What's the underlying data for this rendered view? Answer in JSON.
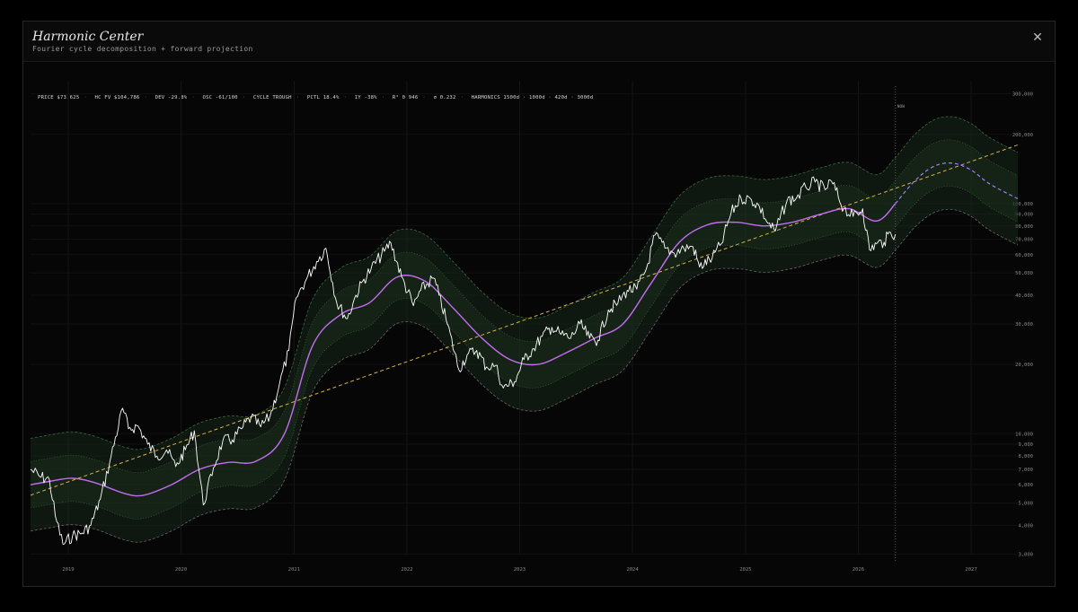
{
  "window": {
    "title": "Harmonic Center",
    "subtitle": "Fourier cycle decomposition + forward projection",
    "close_label": "✕"
  },
  "stats": [
    "PRICE $73,625",
    "HC FV $104,786",
    "DEV -29.8%",
    "OSC -61/100",
    "CYCLE TROUGH",
    "PCTL 18.4%",
    "1Y -38%",
    "R² 0.946",
    "σ 0.232",
    "HARMONICS 1500d · 1000d · 420d · 3000d"
  ],
  "colors": {
    "price": "#ffffff",
    "center": "#c56cf0",
    "projection": "#9f7cf5",
    "trend": "#d8b04a",
    "band_fill": "#1a2e1c",
    "band_line": "#3c6a40"
  },
  "chart_data": {
    "type": "line",
    "y_scale": "log",
    "ylim": [
      2800,
      330000
    ],
    "xlim": [
      "2018-09-01",
      "2027-06-01"
    ],
    "now_label": "NOW",
    "now_date": "2026-05-01",
    "x_ticks": [
      "2019",
      "2020",
      "2021",
      "2022",
      "2023",
      "2024",
      "2025",
      "2026",
      "2027"
    ],
    "y_ticks": [
      {
        "value": 300000,
        "label": "300,000"
      },
      {
        "value": 200000,
        "label": "200,000"
      },
      {
        "value": 100000,
        "label": "100,000"
      },
      {
        "value": 90000,
        "label": "90,000"
      },
      {
        "value": 80000,
        "label": "80,000"
      },
      {
        "value": 70000,
        "label": "70,000"
      },
      {
        "value": 60000,
        "label": "60,000"
      },
      {
        "value": 50000,
        "label": "50,000"
      },
      {
        "value": 40000,
        "label": "40,000"
      },
      {
        "value": 30000,
        "label": "30,000"
      },
      {
        "value": 20000,
        "label": "20,000"
      },
      {
        "value": 10000,
        "label": "10,000"
      },
      {
        "value": 9000,
        "label": "9,000"
      },
      {
        "value": 8000,
        "label": "8,000"
      },
      {
        "value": 7000,
        "label": "7,000"
      },
      {
        "value": 6000,
        "label": "6,000"
      },
      {
        "value": 5000,
        "label": "5,000"
      },
      {
        "value": 4000,
        "label": "4,000"
      },
      {
        "value": 3000,
        "label": "3,000"
      }
    ],
    "series": [
      {
        "role": "price",
        "x": [
          "2018-09-01",
          "2018-10-01",
          "2018-11-01",
          "2018-11-20",
          "2018-12-15",
          "2019-01-15",
          "2019-02-15",
          "2019-03-15",
          "2019-04-15",
          "2019-05-15",
          "2019-06-26",
          "2019-07-15",
          "2019-08-15",
          "2019-09-15",
          "2019-10-15",
          "2019-11-15",
          "2019-12-15",
          "2020-01-15",
          "2020-02-13",
          "2020-03-13",
          "2020-04-15",
          "2020-05-15",
          "2020-06-15",
          "2020-07-15",
          "2020-08-15",
          "2020-09-15",
          "2020-10-15",
          "2020-11-15",
          "2020-12-15",
          "2021-01-08",
          "2021-02-10",
          "2021-03-15",
          "2021-04-14",
          "2021-05-19",
          "2021-06-22",
          "2021-07-20",
          "2021-08-15",
          "2021-09-07",
          "2021-10-20",
          "2021-11-10",
          "2021-12-15",
          "2022-01-22",
          "2022-02-15",
          "2022-03-28",
          "2022-04-15",
          "2022-05-12",
          "2022-06-18",
          "2022-07-15",
          "2022-08-15",
          "2022-09-15",
          "2022-10-15",
          "2022-11-09",
          "2022-12-15",
          "2023-01-15",
          "2023-02-15",
          "2023-03-15",
          "2023-04-15",
          "2023-05-15",
          "2023-06-15",
          "2023-07-15",
          "2023-08-15",
          "2023-09-11",
          "2023-10-15",
          "2023-11-15",
          "2023-12-15",
          "2024-01-15",
          "2024-02-15",
          "2024-03-14",
          "2024-04-15",
          "2024-05-15",
          "2024-06-15",
          "2024-07-15",
          "2024-08-05",
          "2024-09-15",
          "2024-10-15",
          "2024-11-15",
          "2024-12-17",
          "2025-01-20",
          "2025-02-15",
          "2025-03-15",
          "2025-04-07",
          "2025-05-15",
          "2025-06-15",
          "2025-07-15",
          "2025-08-14",
          "2025-09-15",
          "2025-10-06",
          "2025-11-15",
          "2025-12-15",
          "2026-01-15",
          "2026-02-06",
          "2026-03-01",
          "2026-03-25",
          "2026-04-15",
          "2026-05-01"
        ],
        "values": [
          7000,
          6500,
          6300,
          4400,
          3300,
          3600,
          3700,
          4000,
          5200,
          7500,
          12900,
          10500,
          10800,
          9000,
          8000,
          8500,
          7200,
          8500,
          10300,
          4900,
          7100,
          9300,
          9400,
          10500,
          11800,
          10700,
          11900,
          16500,
          23000,
          39000,
          47000,
          56000,
          64000,
          37000,
          31600,
          40000,
          47000,
          52000,
          62000,
          67500,
          48000,
          36000,
          42000,
          47500,
          40000,
          30000,
          19000,
          22000,
          23000,
          19500,
          19800,
          15800,
          16800,
          21000,
          23500,
          26500,
          29000,
          27000,
          26000,
          30000,
          26000,
          25500,
          34500,
          37000,
          42000,
          42500,
          52000,
          73000,
          64000,
          61000,
          64000,
          65000,
          53000,
          58000,
          67000,
          91000,
          106000,
          104000,
          97000,
          82000,
          76000,
          103000,
          106000,
          118000,
          124000,
          115000,
          125000,
          95000,
          88000,
          95000,
          63000,
          67000,
          68000,
          75000,
          73625
        ]
      },
      {
        "role": "center",
        "x": [
          "2018-09-01",
          "2018-11-01",
          "2019-01-15",
          "2019-04-01",
          "2019-07-01",
          "2019-09-01",
          "2019-12-01",
          "2020-03-01",
          "2020-06-01",
          "2020-09-01",
          "2020-12-01",
          "2021-03-01",
          "2021-06-01",
          "2021-09-01",
          "2021-12-01",
          "2022-03-01",
          "2022-06-01",
          "2022-09-01",
          "2022-12-01",
          "2023-03-01",
          "2023-06-01",
          "2023-09-01",
          "2023-12-01",
          "2024-03-01",
          "2024-06-01",
          "2024-09-01",
          "2024-12-01",
          "2025-03-01",
          "2025-06-01",
          "2025-09-01",
          "2025-12-01",
          "2026-03-01",
          "2026-05-01"
        ],
        "values": [
          6000,
          6200,
          6400,
          6100,
          5500,
          5400,
          6000,
          7000,
          7500,
          7600,
          10000,
          24000,
          33000,
          37000,
          48000,
          46000,
          35000,
          26000,
          21000,
          20000,
          22500,
          26000,
          30000,
          45000,
          68000,
          81000,
          83000,
          80000,
          83000,
          90000,
          95000,
          84000,
          100000
        ]
      },
      {
        "role": "projection",
        "x": [
          "2026-05-01",
          "2026-07-01",
          "2026-09-01",
          "2026-11-01",
          "2027-01-01",
          "2027-03-01",
          "2027-06-01"
        ],
        "values": [
          100000,
          125000,
          145000,
          150000,
          140000,
          122000,
          105000
        ]
      },
      {
        "role": "trend",
        "x": [
          "2018-09-01",
          "2027-06-01"
        ],
        "values": [
          5400,
          180000
        ]
      }
    ],
    "band_sigma": [
      0.232,
      0.464
    ]
  }
}
